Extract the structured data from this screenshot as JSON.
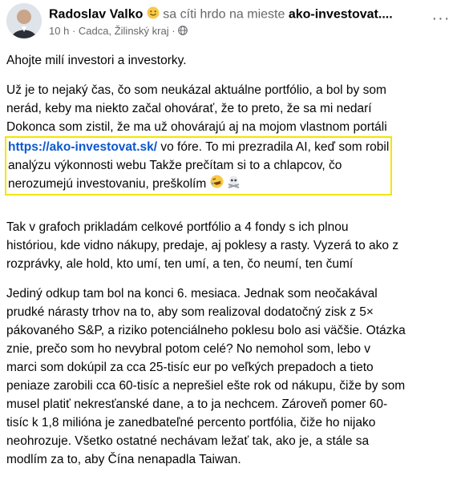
{
  "header": {
    "author": "Radoslav Valko",
    "feeling": "sa cíti hrdo na mieste",
    "place": "ako-investovat....",
    "time": "10 h",
    "sep": "·",
    "location": "Cadca, Žilinský kraj",
    "more_label": "···"
  },
  "body": {
    "p1": "Ahojte milí investori a investorky.",
    "p2_l1": "Už je to nejaký čas, čo som neukázal aktuálne portfólio, a bol by som",
    "p2_l2": "nerád, keby ma niekto začal ohovárať, že to preto, že sa mi nedarí",
    "p2_l3": "Dokonca som zistil, že ma už ohovárajú aj na mojom vlastnom portáli",
    "link": "https://ako-investovat.sk/",
    "p2_l4_rest": "vo fóre. To mi prezradila AI, keď som robil",
    "p2_l5": "analýzu výkonnosti webu Takže prečítam si to a chlapcov, čo",
    "p2_l6": "nerozumejú investovaniu, preškolím",
    "p3_l1": "Tak v grafoch prikladám celkové portfólio a 4 fondy s ich plnou",
    "p3_l2": "históriou, kde vidno nákupy, predaje, aj poklesy a rasty. Vyzerá to ako z",
    "p3_l3": "rozprávky, ale hold, kto umí, ten umí, a ten, čo neumí, ten čumí",
    "p4_l1": "Jediný odkup tam bol na konci 6. mesiaca. Jednak som neočakával",
    "p4_l2": "prudké nárasty trhov na to, aby som realizoval dodatočný zisk z 5×",
    "p4_l3": "pákovaného S&P, a riziko potenciálneho poklesu bolo asi väčšie. Otázka",
    "p4_l4": "znie, prečo som ho nevybral potom celé? No nemohol som, lebo v",
    "p4_l5": "marci som dokúpil za cca 25-tisíc eur po veľkých prepadoch a tieto",
    "p4_l6": "peniaze zarobili cca 60-tisíc a neprešiel ešte rok od nákupu, čiže by som",
    "p4_l7": "musel platiť nekresťanské dane, a to ja nechcem. Zároveň pomer 60-",
    "p4_l8": "tisíc k 1,8 milióna je zanedbateľné percento portfólia, čiže ho nijako",
    "p4_l9": "neohrozuje. Všetko ostatné nechávam ležať tak, ako je, a stále sa",
    "p4_l10": "modlím za to, aby Čína nenapadla Taiwan."
  },
  "icons": {
    "feeling": "smiling-face-icon",
    "globe": "globe-icon",
    "rofl": "rolling-on-floor-laughing-icon",
    "skull": "skull-crossbones-icon"
  },
  "colors": {
    "link": "#0b57d0",
    "highlight_border": "#f2e600",
    "muted": "#65676b"
  }
}
